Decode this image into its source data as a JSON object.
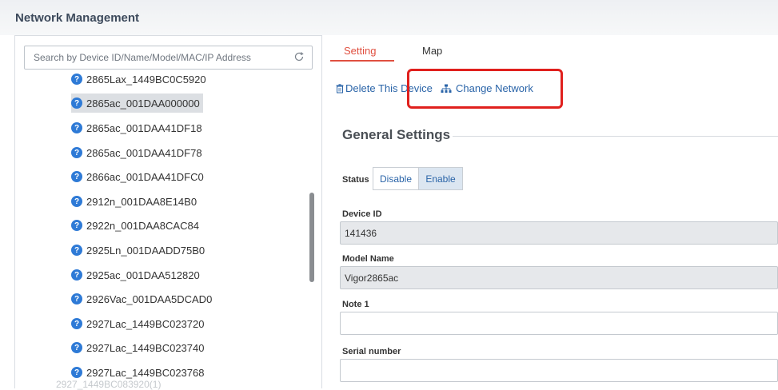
{
  "header": {
    "title": "Network Management"
  },
  "search": {
    "placeholder": "Search by Device ID/Name/Model/MAC/IP Address"
  },
  "devices": [
    "2865Lax_1449BC0C5920",
    "2865ac_001DAA000000",
    "2865ac_001DAA41DF18",
    "2865ac_001DAA41DF78",
    "2866ac_001DAA41DFC0",
    "2912n_001DAA8E14B0",
    "2922n_001DAA8CAC84",
    "2925Ln_001DAADD75B0",
    "2925ac_001DAA512820",
    "2926Vac_001DAA5DCAD0",
    "2927Lac_1449BC023720",
    "2927Lac_1449BC023740",
    "2927Lac_1449BC023768"
  ],
  "selected_device_index": 1,
  "device_faded": "2927_1449BC083920(1)",
  "tabs": {
    "setting": "Setting",
    "map": "Map"
  },
  "toolbar": {
    "delete_label": "Delete This Device",
    "change_label": "Change Network"
  },
  "general": {
    "title": "General Settings",
    "status_label": "Status",
    "status_options": [
      "Disable",
      "Enable"
    ],
    "status_selected": "Enable",
    "device_id_label": "Device ID",
    "device_id_value": "141436",
    "model_label": "Model Name",
    "model_value": "Vigor2865ac",
    "note1_label": "Note 1",
    "note1_value": "",
    "serial_label": "Serial number",
    "serial_value": ""
  },
  "colors": {
    "accent": "#e05040",
    "link": "#2a64a8",
    "help_icon": "#2e7ad6",
    "highlight": "#e0201d"
  },
  "icons": {
    "search_refresh": "refresh-icon",
    "device": "help-circle-icon",
    "delete": "trash-icon",
    "change": "network-icon"
  }
}
